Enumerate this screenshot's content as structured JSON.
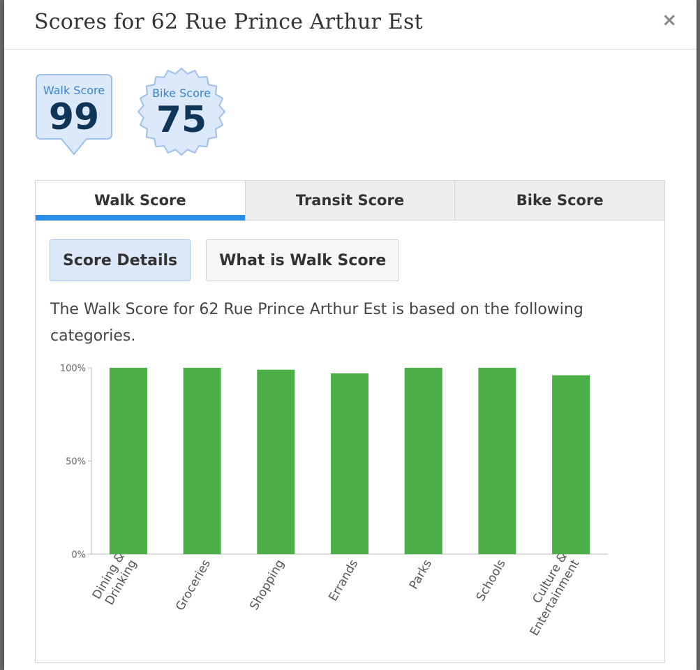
{
  "modal": {
    "title": "Scores for 62 Rue Prince Arthur Est",
    "close_symbol": "×"
  },
  "badges": {
    "walk": {
      "label": "Walk Score",
      "value": "99",
      "icon": "walk-score-badge"
    },
    "bike": {
      "label": "Bike Score",
      "value": "75",
      "icon": "bike-score-gear-badge"
    }
  },
  "tabs": [
    {
      "label": "Walk Score",
      "active": true
    },
    {
      "label": "Transit Score",
      "active": false
    },
    {
      "label": "Bike Score",
      "active": false
    }
  ],
  "subtabs": [
    {
      "label": "Score Details",
      "active": true
    },
    {
      "label": "What is Walk Score",
      "active": false
    }
  ],
  "description": "The Walk Score for 62 Rue Prince Arthur Est is based on the following categories.",
  "colors": {
    "accent": "#2b8fea",
    "bar": "#4cae47",
    "badge_text": "#0f3559",
    "badge_label": "#3b84c9"
  },
  "chart_data": {
    "type": "bar",
    "categories": [
      [
        "Dining &",
        "Drinking"
      ],
      [
        "Groceries"
      ],
      [
        "Shopping"
      ],
      [
        "Errands"
      ],
      [
        "Parks"
      ],
      [
        "Schools"
      ],
      [
        "Culture &",
        "Entertainment"
      ]
    ],
    "values": [
      100,
      100,
      99,
      97,
      100,
      100,
      96
    ],
    "y_ticks": [
      {
        "value": 100,
        "label": "100%"
      },
      {
        "value": 50,
        "label": "50%"
      },
      {
        "value": 0,
        "label": "0%"
      }
    ],
    "ylim": [
      0,
      100
    ],
    "grid": false,
    "legend": "none"
  }
}
